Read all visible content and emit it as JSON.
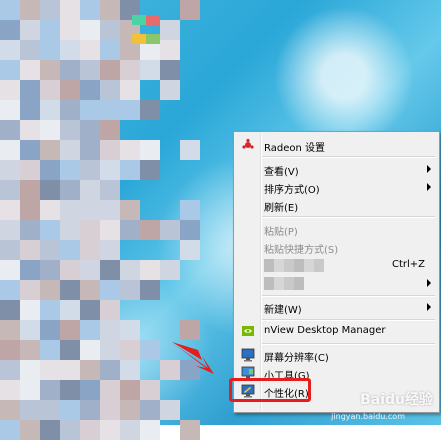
{
  "context_menu": {
    "items": [
      {
        "label": "Radeon 设置",
        "icon": "radeon-icon"
      },
      {
        "label": "查看(V)",
        "submenu": true
      },
      {
        "label": "排序方式(O)",
        "submenu": true
      },
      {
        "label": "刷新(E)"
      },
      {
        "label": "粘贴(P)",
        "disabled": true
      },
      {
        "label": "粘贴快捷方式(S)",
        "disabled": true
      },
      {
        "label": "",
        "shortcut": "Ctrl+Z",
        "blurred": true
      },
      {
        "label": "",
        "submenu": true,
        "blurred": true
      },
      {
        "label": "新建(W)",
        "submenu": true
      },
      {
        "label": "nView Desktop Manager",
        "icon": "nview-icon"
      },
      {
        "label": "屏幕分辨率(C)",
        "icon": "display-icon"
      },
      {
        "label": "小工具(G)",
        "icon": "gadgets-icon"
      },
      {
        "label": "个性化(R)",
        "icon": "personalize-icon"
      }
    ]
  },
  "watermark": {
    "text": "Baidu经验",
    "url": "jingyan.baidu.com"
  },
  "colors": {
    "highlight": "#e51d1d",
    "arrow": "#e51d1d"
  }
}
